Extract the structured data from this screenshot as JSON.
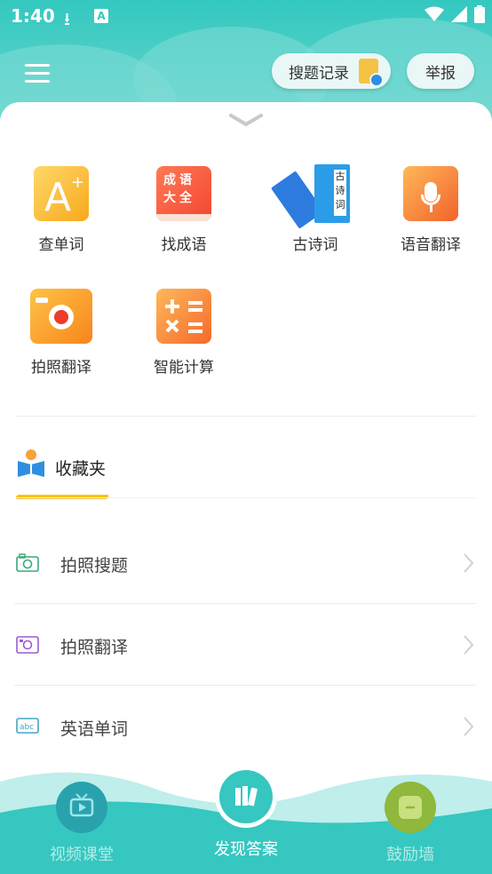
{
  "status_bar": {
    "time": "1:40",
    "download_icon": "download-icon",
    "a_icon": "A"
  },
  "header": {
    "history_label": "搜题记录",
    "report_label": "举报"
  },
  "tools": [
    {
      "label": "查单词",
      "icon": "dictionary-icon"
    },
    {
      "label": "找成语",
      "icon": "idiom-book-icon"
    },
    {
      "label": "古诗词",
      "icon": "poetry-books-icon"
    },
    {
      "label": "语音翻译",
      "icon": "microphone-icon"
    },
    {
      "label": "拍照翻译",
      "icon": "camera-icon"
    },
    {
      "label": "智能计算",
      "icon": "calculator-icon"
    }
  ],
  "idiom_tile_text": [
    "成",
    "语",
    "大",
    "全"
  ],
  "poetry_tile_text": [
    "古",
    "诗",
    "词"
  ],
  "favorites": {
    "title": "收藏夹",
    "items": [
      {
        "label": "拍照搜题",
        "icon": "camera-outline-icon",
        "color": "#3aa87a"
      },
      {
        "label": "拍照翻译",
        "icon": "photo-outline-icon",
        "color": "#9a5cd0"
      },
      {
        "label": "英语单词",
        "icon": "abc-outline-icon",
        "color": "#43a6c9"
      }
    ]
  },
  "bottom_nav": [
    {
      "label": "视频课堂",
      "icon": "tv-icon",
      "active": false
    },
    {
      "label": "发现答案",
      "icon": "books-icon",
      "active": true
    },
    {
      "label": "鼓励墙",
      "icon": "message-icon",
      "active": false
    }
  ],
  "colors": {
    "accent": "#35c7c0",
    "underline": "#f8c21c"
  }
}
